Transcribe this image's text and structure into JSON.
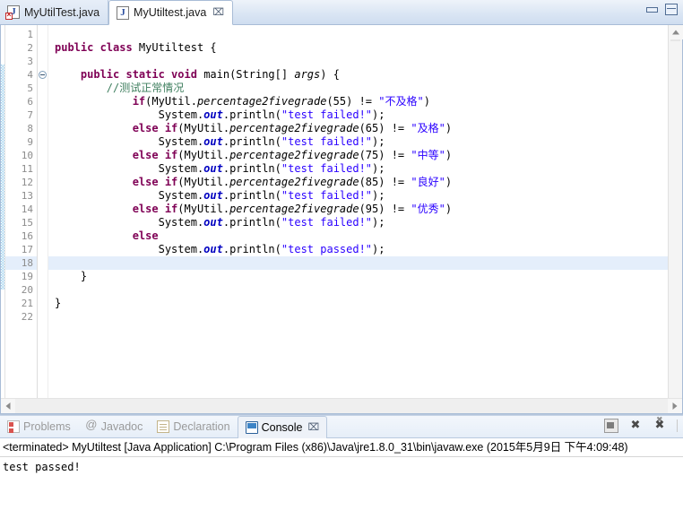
{
  "editor": {
    "tabs": [
      {
        "label": "MyUtilTest.java",
        "icon": "java-file-error-icon",
        "active": false,
        "closable": false
      },
      {
        "label": "MyUtiltest.java",
        "icon": "java-file-icon",
        "active": true,
        "closable": true,
        "close_glyph": "⌧"
      }
    ],
    "window_controls": {
      "minimize": "minimize",
      "maximize": "maximize"
    },
    "current_line": 18,
    "lines": [
      {
        "n": 1,
        "tokens": []
      },
      {
        "n": 2,
        "tokens": [
          {
            "t": "public class ",
            "c": "kw"
          },
          {
            "t": "MyUtiltest {",
            "c": "plain"
          }
        ]
      },
      {
        "n": 3,
        "tokens": []
      },
      {
        "n": 4,
        "fold": true,
        "tokens": [
          {
            "t": "    ",
            "c": "plain"
          },
          {
            "t": "public static void ",
            "c": "kw"
          },
          {
            "t": "main(String[] ",
            "c": "plain"
          },
          {
            "t": "args",
            "c": "stat"
          },
          {
            "t": ") {",
            "c": "plain"
          }
        ]
      },
      {
        "n": 5,
        "tokens": [
          {
            "t": "        //测试正常情况",
            "c": "cmt"
          }
        ]
      },
      {
        "n": 6,
        "tokens": [
          {
            "t": "            ",
            "c": "plain"
          },
          {
            "t": "if",
            "c": "kw"
          },
          {
            "t": "(MyUtil.",
            "c": "plain"
          },
          {
            "t": "percentage2fivegrade",
            "c": "stat"
          },
          {
            "t": "(55) != ",
            "c": "plain"
          },
          {
            "t": "\"不及格\"",
            "c": "str"
          },
          {
            "t": ")",
            "c": "plain"
          }
        ]
      },
      {
        "n": 7,
        "tokens": [
          {
            "t": "                System.",
            "c": "plain"
          },
          {
            "t": "out",
            "c": "fld"
          },
          {
            "t": ".println(",
            "c": "plain"
          },
          {
            "t": "\"test failed!\"",
            "c": "str"
          },
          {
            "t": ");",
            "c": "plain"
          }
        ]
      },
      {
        "n": 8,
        "tokens": [
          {
            "t": "            ",
            "c": "plain"
          },
          {
            "t": "else if",
            "c": "kw"
          },
          {
            "t": "(MyUtil.",
            "c": "plain"
          },
          {
            "t": "percentage2fivegrade",
            "c": "stat"
          },
          {
            "t": "(65) != ",
            "c": "plain"
          },
          {
            "t": "\"及格\"",
            "c": "str"
          },
          {
            "t": ")",
            "c": "plain"
          }
        ]
      },
      {
        "n": 9,
        "tokens": [
          {
            "t": "                System.",
            "c": "plain"
          },
          {
            "t": "out",
            "c": "fld"
          },
          {
            "t": ".println(",
            "c": "plain"
          },
          {
            "t": "\"test failed!\"",
            "c": "str"
          },
          {
            "t": ");",
            "c": "plain"
          }
        ]
      },
      {
        "n": 10,
        "tokens": [
          {
            "t": "            ",
            "c": "plain"
          },
          {
            "t": "else if",
            "c": "kw"
          },
          {
            "t": "(MyUtil.",
            "c": "plain"
          },
          {
            "t": "percentage2fivegrade",
            "c": "stat"
          },
          {
            "t": "(75) != ",
            "c": "plain"
          },
          {
            "t": "\"中等\"",
            "c": "str"
          },
          {
            "t": ")",
            "c": "plain"
          }
        ]
      },
      {
        "n": 11,
        "tokens": [
          {
            "t": "                System.",
            "c": "plain"
          },
          {
            "t": "out",
            "c": "fld"
          },
          {
            "t": ".println(",
            "c": "plain"
          },
          {
            "t": "\"test failed!\"",
            "c": "str"
          },
          {
            "t": ");",
            "c": "plain"
          }
        ]
      },
      {
        "n": 12,
        "tokens": [
          {
            "t": "            ",
            "c": "plain"
          },
          {
            "t": "else if",
            "c": "kw"
          },
          {
            "t": "(MyUtil.",
            "c": "plain"
          },
          {
            "t": "percentage2fivegrade",
            "c": "stat"
          },
          {
            "t": "(85) != ",
            "c": "plain"
          },
          {
            "t": "\"良好\"",
            "c": "str"
          },
          {
            "t": ")",
            "c": "plain"
          }
        ]
      },
      {
        "n": 13,
        "tokens": [
          {
            "t": "                System.",
            "c": "plain"
          },
          {
            "t": "out",
            "c": "fld"
          },
          {
            "t": ".println(",
            "c": "plain"
          },
          {
            "t": "\"test failed!\"",
            "c": "str"
          },
          {
            "t": ");",
            "c": "plain"
          }
        ]
      },
      {
        "n": 14,
        "tokens": [
          {
            "t": "            ",
            "c": "plain"
          },
          {
            "t": "else if",
            "c": "kw"
          },
          {
            "t": "(MyUtil.",
            "c": "plain"
          },
          {
            "t": "percentage2fivegrade",
            "c": "stat"
          },
          {
            "t": "(95) != ",
            "c": "plain"
          },
          {
            "t": "\"优秀\"",
            "c": "str"
          },
          {
            "t": ")",
            "c": "plain"
          }
        ]
      },
      {
        "n": 15,
        "tokens": [
          {
            "t": "                System.",
            "c": "plain"
          },
          {
            "t": "out",
            "c": "fld"
          },
          {
            "t": ".println(",
            "c": "plain"
          },
          {
            "t": "\"test failed!\"",
            "c": "str"
          },
          {
            "t": ");",
            "c": "plain"
          }
        ]
      },
      {
        "n": 16,
        "tokens": [
          {
            "t": "            ",
            "c": "plain"
          },
          {
            "t": "else",
            "c": "kw"
          }
        ]
      },
      {
        "n": 17,
        "tokens": [
          {
            "t": "                System.",
            "c": "plain"
          },
          {
            "t": "out",
            "c": "fld"
          },
          {
            "t": ".println(",
            "c": "plain"
          },
          {
            "t": "\"test passed!\"",
            "c": "str"
          },
          {
            "t": ");",
            "c": "plain"
          }
        ]
      },
      {
        "n": 18,
        "tokens": []
      },
      {
        "n": 19,
        "tokens": [
          {
            "t": "    }",
            "c": "plain"
          }
        ]
      },
      {
        "n": 20,
        "tokens": []
      },
      {
        "n": 21,
        "tokens": [
          {
            "t": "}",
            "c": "plain"
          }
        ]
      },
      {
        "n": 22,
        "tokens": []
      }
    ]
  },
  "console": {
    "tabs": [
      {
        "label": "Problems",
        "icon": "problems-icon",
        "active": false,
        "closable": false
      },
      {
        "label": "Javadoc",
        "icon": "javadoc-icon",
        "active": false,
        "closable": false
      },
      {
        "label": "Declaration",
        "icon": "declaration-icon",
        "active": false,
        "closable": false
      },
      {
        "label": "Console",
        "icon": "console-icon",
        "active": true,
        "closable": true,
        "close_glyph": "⌧"
      }
    ],
    "toolbar": [
      {
        "name": "display-selected-console-button",
        "glyph": "display"
      },
      {
        "name": "remove-launch-button",
        "glyph": "x"
      },
      {
        "name": "remove-all-terminated-button",
        "glyph": "xall"
      }
    ],
    "header": "<terminated> MyUtiltest [Java Application] C:\\Program Files (x86)\\Java\\jre1.8.0_31\\bin\\javaw.exe (2015年5月9日 下午4:09:48)",
    "output": "test passed!"
  },
  "colors": {
    "keyword": "#7f0055",
    "string": "#2a00ff",
    "comment": "#3f7f5f",
    "static_field": "#0000c0",
    "current_line_bg": "#e4eefb",
    "tab_active_bg": "#ffffff",
    "chrome_blue": "#d9e4f2"
  }
}
